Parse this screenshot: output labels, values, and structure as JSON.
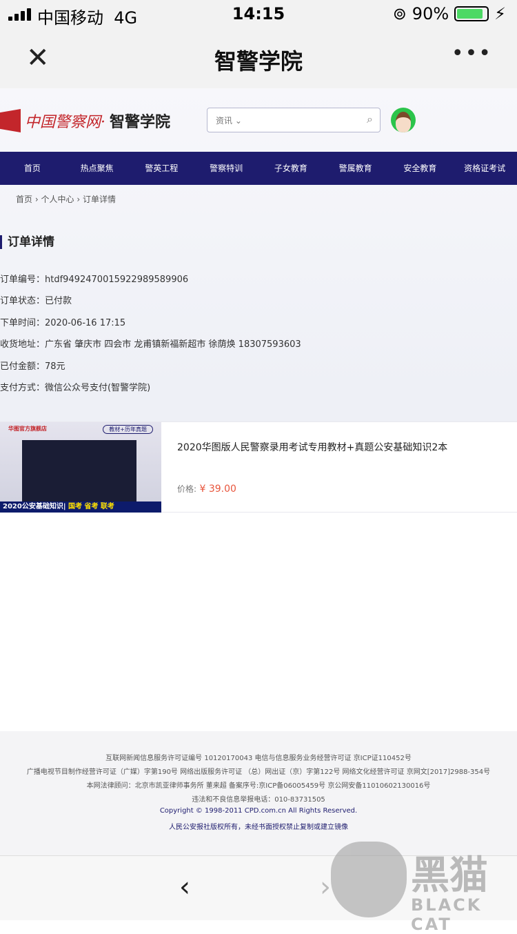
{
  "status": {
    "carrier": "中国移动",
    "network": "4G",
    "time": "14:15",
    "battery": "90%",
    "battery_level": 0.9
  },
  "navbar": {
    "title": "智警学院",
    "close_icon": "close-icon",
    "more_icon": "more-icon"
  },
  "header": {
    "logo_red": "中国警察网·",
    "logo_black": "智警学院",
    "search_category": "资讯 ⌄",
    "search_placeholder": ""
  },
  "menu": [
    "首页",
    "热点聚焦",
    "警英工程",
    "警察特训",
    "子女教育",
    "警属教育",
    "安全教育",
    "资格证考试"
  ],
  "breadcrumb": {
    "items": [
      "首页",
      "个人中心",
      "订单详情"
    ],
    "sep": "›"
  },
  "section_title": "订单详情",
  "order": [
    {
      "label": "订单编号：",
      "value": "htdf949247001592298958990​6"
    },
    {
      "label": "订单状态：",
      "value": "已付款"
    },
    {
      "label": "下单时间：",
      "value": "2020-06-16 17:15"
    },
    {
      "label": "收货地址：",
      "value": "广东省 肇庆市 四会市 龙甫镇新福新超市 徐荫焕 18307593603"
    },
    {
      "label": "已付金额：",
      "value": "78元"
    },
    {
      "label": "支付方式：",
      "value": "微信公众号支付(智警学院)"
    }
  ],
  "product": {
    "name": "2020华图版人民警察录用考试专用教材+真题公安基础知识2本",
    "price_label": "价格:",
    "price": " ¥ 39.00",
    "img_shop": "华图官方旗舰店",
    "img_tag": "教材+历年真题",
    "img_band": "2020公安基础知识|",
    "img_band2": " 国考 省考 联考"
  },
  "footer": [
    "互联网新闻信息服务许可证编号 10120170043  电信与信息服务业务经营许可证 京ICP证110452号",
    "广播电视节目制作经营许可证（广媒）字第190号  网络出版服务许可证 （总）网出证（京）字第122号  网络文化经营许可证 京网文[2017]2988-354号",
    "本网法律顾问：北京市凯亚律师事务所 董来超  备案序号:京ICP备06005459号  京公网安备11010602130016号",
    "违法和不良信息举报电话：010-83731505",
    "Copyright © 1998-2011    CPD.com.cn    All Rights Reserved.",
    "人民公安报社版权所有，未经书面授权禁止复制或建立镜像"
  ],
  "watermark": {
    "cn": "黑猫",
    "en": "BLACK CAT"
  }
}
